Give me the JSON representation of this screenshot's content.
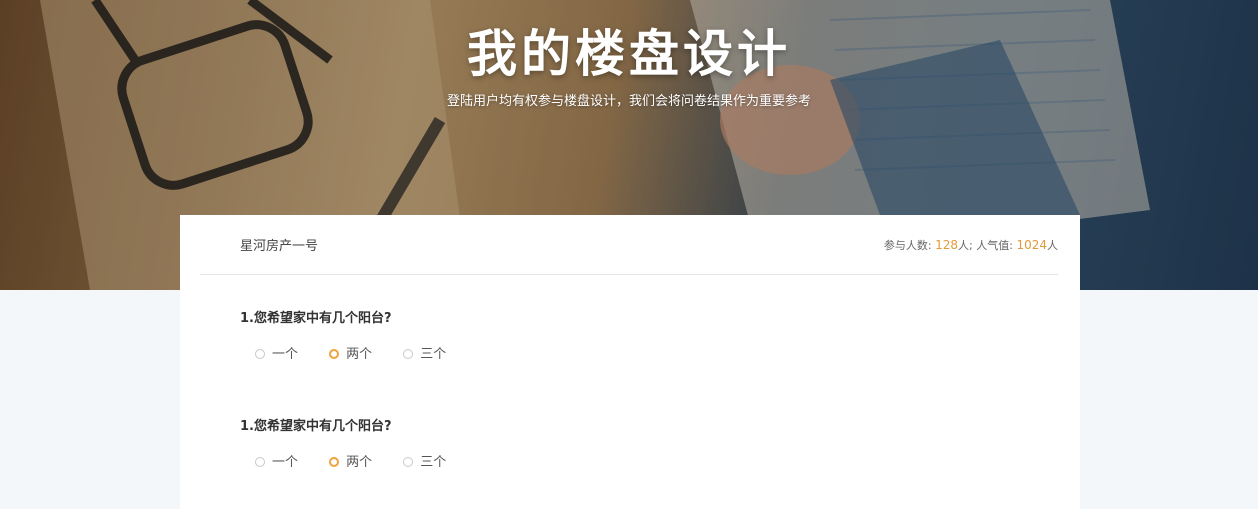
{
  "hero": {
    "title": "我的楼盘设计",
    "subtitle": "登陆用户均有权参与楼盘设计，我们会将问卷结果作为重要参考"
  },
  "card": {
    "project_name": "星河房产一号",
    "stats": {
      "participants_label": "参与人数:",
      "participants_value": "128",
      "participants_unit": "人;",
      "popularity_label": "人气值:",
      "popularity_value": "1024",
      "popularity_unit": "人"
    }
  },
  "questions": [
    {
      "title": "1.您希望家中有几个阳台?",
      "options": [
        "一个",
        "两个",
        "三个"
      ],
      "selected": "两个"
    },
    {
      "title": "1.您希望家中有几个阳台?",
      "options": [
        "一个",
        "两个",
        "三个"
      ],
      "selected": "两个"
    }
  ],
  "colors": {
    "accent": "#f0a23b",
    "stat_number": "#e39a3c",
    "page_background": "#f4f7fa"
  }
}
